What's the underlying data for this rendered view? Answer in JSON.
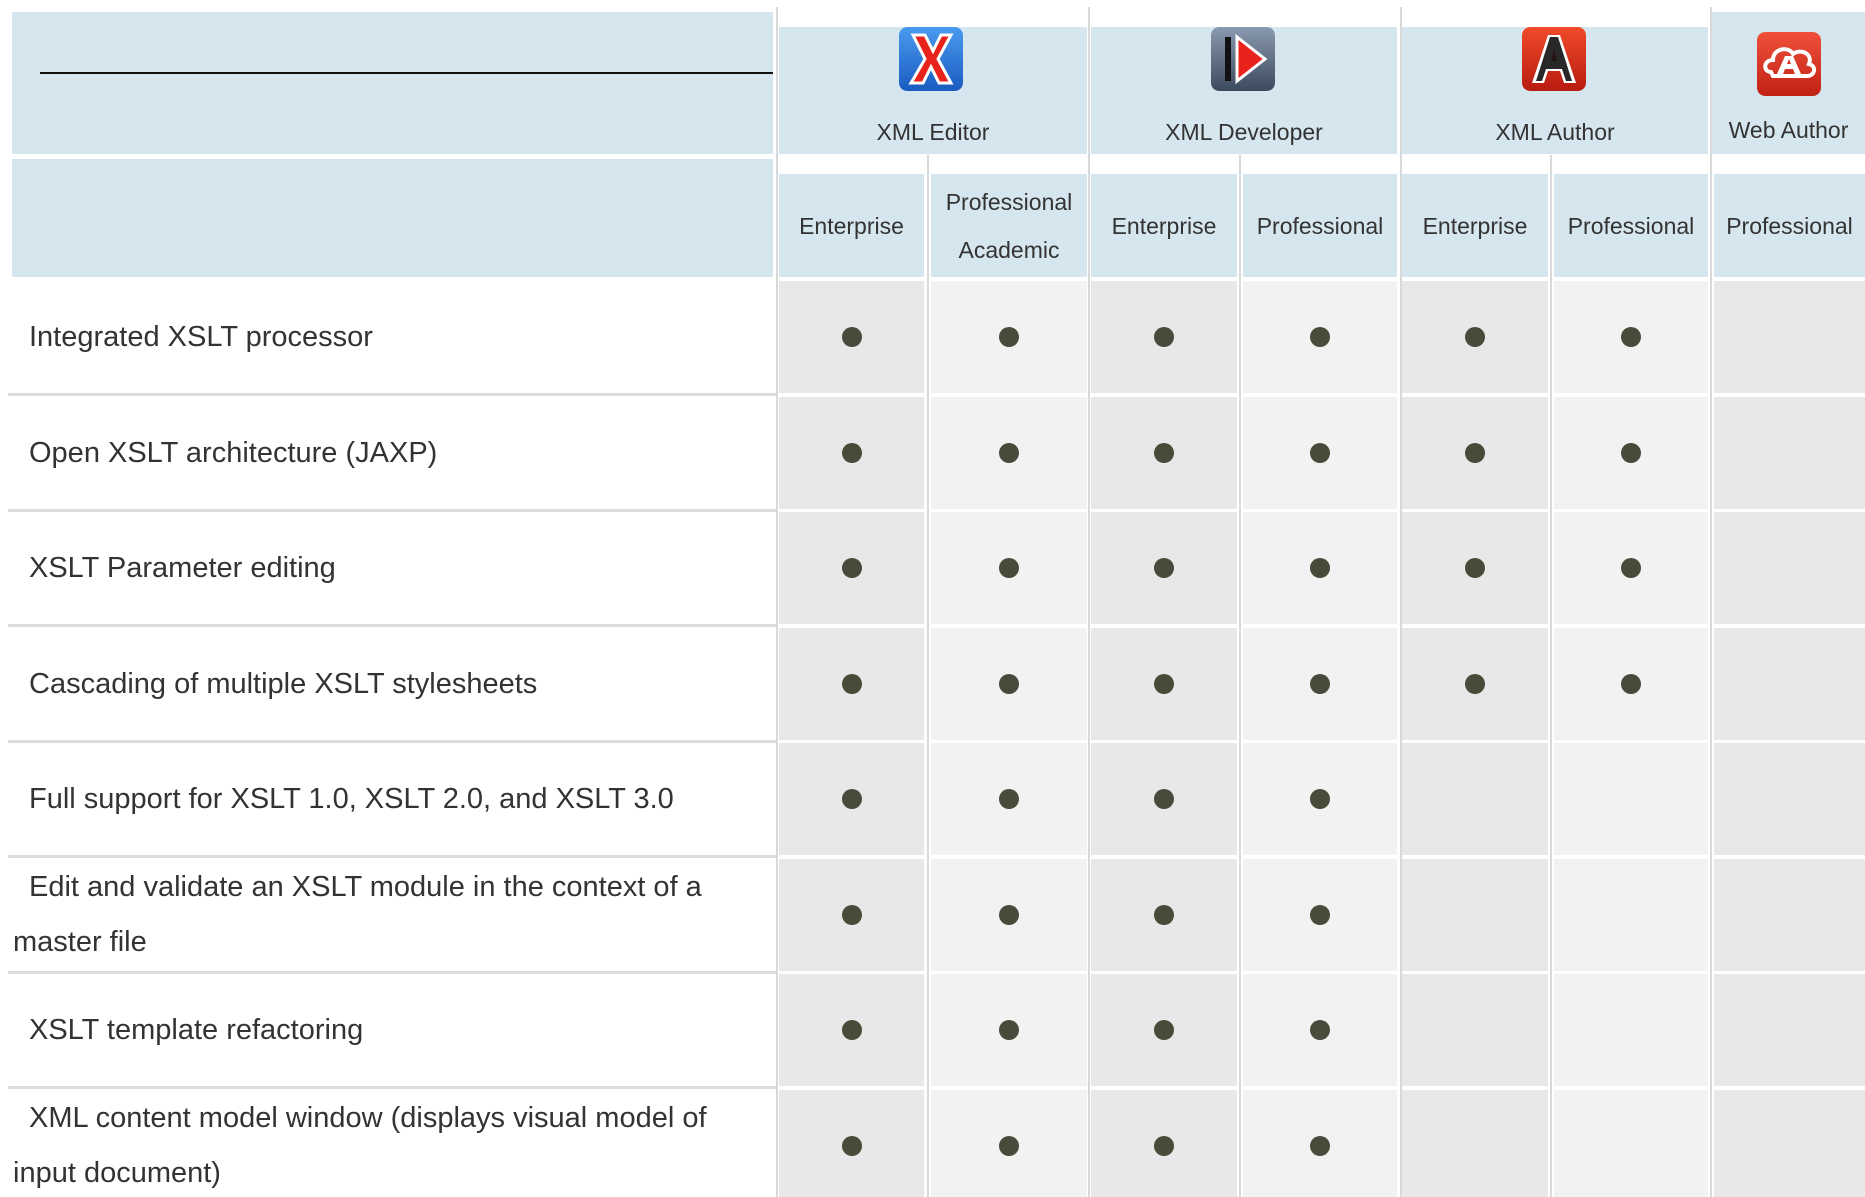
{
  "products": [
    {
      "name": "XML Editor",
      "logo_icon": "xml-editor-logo-icon",
      "logo_color": "#2a6fd6"
    },
    {
      "name": "XML Developer",
      "logo_icon": "xml-developer-logo-icon",
      "logo_color": "#5a6a80"
    },
    {
      "name": "XML Author",
      "logo_icon": "xml-author-logo-icon",
      "logo_color": "#d23a1a"
    },
    {
      "name": "Web Author",
      "logo_icon": "web-author-logo-icon",
      "logo_color": "#d8361a"
    }
  ],
  "editions": [
    {
      "product": "XML Editor",
      "lines": [
        "Enterprise"
      ]
    },
    {
      "product": "XML Editor",
      "lines": [
        "Professional",
        "Academic"
      ]
    },
    {
      "product": "XML Developer",
      "lines": [
        "Enterprise"
      ]
    },
    {
      "product": "XML Developer",
      "lines": [
        "Professional"
      ]
    },
    {
      "product": "XML Author",
      "lines": [
        "Enterprise"
      ]
    },
    {
      "product": "XML Author",
      "lines": [
        "Professional"
      ]
    },
    {
      "product": "Web Author",
      "lines": [
        "Professional"
      ]
    }
  ],
  "features": [
    {
      "label": "Integrated XSLT processor",
      "support": [
        true,
        true,
        true,
        true,
        true,
        true,
        false
      ]
    },
    {
      "label": "Open XSLT architecture (JAXP)",
      "support": [
        true,
        true,
        true,
        true,
        true,
        true,
        false
      ]
    },
    {
      "label": "XSLT Parameter editing",
      "support": [
        true,
        true,
        true,
        true,
        true,
        true,
        false
      ]
    },
    {
      "label": "Cascading of multiple XSLT stylesheets",
      "support": [
        true,
        true,
        true,
        true,
        true,
        true,
        false
      ]
    },
    {
      "label": "Full support for XSLT 1.0, XSLT 2.0, and XSLT 3.0",
      "support": [
        true,
        true,
        true,
        true,
        false,
        false,
        false
      ]
    },
    {
      "label": "Edit and validate an XSLT module in the context of a master file",
      "support": [
        true,
        true,
        true,
        true,
        false,
        false,
        false
      ]
    },
    {
      "label": "XSLT template refactoring",
      "support": [
        true,
        true,
        true,
        true,
        false,
        false,
        false
      ]
    },
    {
      "label": "XML content model window (displays visual model of input document)",
      "support": [
        true,
        true,
        true,
        true,
        false,
        false,
        false
      ]
    }
  ],
  "colors": {
    "header_bg": "#d6e6ef",
    "cell_dark": "#e9e7e7",
    "cell_light": "#f2f2f2",
    "dot": "#4a4a3a"
  }
}
